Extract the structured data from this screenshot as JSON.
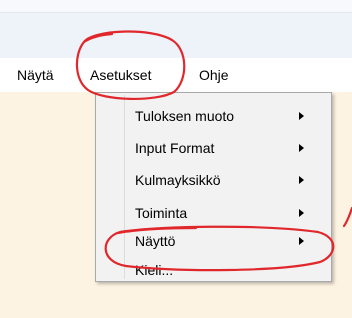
{
  "menubar": {
    "items": [
      {
        "label": "Näytä"
      },
      {
        "label": "Asetukset"
      },
      {
        "label": "Ohje"
      }
    ]
  },
  "settings_menu": {
    "items": [
      {
        "label": "Tuloksen muoto",
        "submenu": true
      },
      {
        "label": "Input Format",
        "submenu": true
      },
      {
        "label": "Kulmayksikkö",
        "submenu": true
      },
      {
        "label": "Toiminta",
        "submenu": true
      },
      {
        "label": "Näyttö",
        "submenu": true
      },
      {
        "label": "Kieli...",
        "submenu": false
      }
    ]
  },
  "annotation_color": "#e0282c",
  "icons": [
    "chevron-right-icon"
  ]
}
